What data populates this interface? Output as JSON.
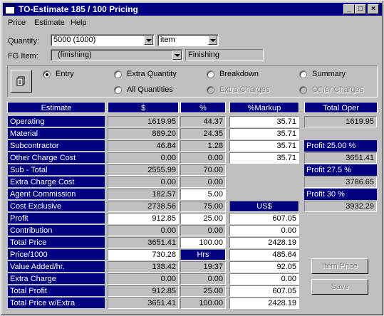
{
  "window": {
    "title": "TO-Estimate 185 / 100  Pricing"
  },
  "menu": [
    {
      "label": "Price"
    },
    {
      "label": "Estimate"
    },
    {
      "label": "Help"
    }
  ],
  "quantity": {
    "label": "Quantity:",
    "value": "5000  (1000)",
    "unit": "item"
  },
  "fg_item": {
    "label": "FG Item:",
    "value": "(finishing)",
    "desc": "Finishing"
  },
  "modes": [
    {
      "label": "Entry",
      "selected": true,
      "enabled": true
    },
    {
      "label": "Extra Quantity",
      "selected": false,
      "enabled": true
    },
    {
      "label": "Breakdown",
      "selected": false,
      "enabled": true
    },
    {
      "label": "Summary",
      "selected": false,
      "enabled": true
    },
    {
      "label": "All Quantities",
      "selected": false,
      "enabled": true
    },
    {
      "label": "Extra Charges",
      "selected": false,
      "enabled": false
    },
    {
      "label": "Other Charges",
      "selected": false,
      "enabled": false
    }
  ],
  "headers": {
    "estimate": "Estimate",
    "dollar": "$",
    "pct": "%",
    "markup": "%Markup",
    "total_oper": "Total Oper"
  },
  "rows": [
    {
      "label": "Operating",
      "dollar": "1619.95",
      "pct": "44.37",
      "markup": "35.71"
    },
    {
      "label": "Material",
      "dollar": "889.20",
      "pct": "24.35",
      "markup": "35.71"
    },
    {
      "label": "Subcontractor",
      "dollar": "46.84",
      "pct": "1.28",
      "markup": "35.71"
    },
    {
      "label": "Other Charge Cost",
      "dollar": "0.00",
      "pct": "0.00",
      "markup": "35.71"
    },
    {
      "label": "Sub - Total",
      "dollar": "2555.99",
      "pct": "70.00",
      "markup": ""
    },
    {
      "label": "Extra Charge Cost",
      "dollar": "0.00",
      "pct": "0.00",
      "markup": ""
    },
    {
      "label": "Agent Commission",
      "dollar": "182.57",
      "pct": "5.00",
      "markup": ""
    },
    {
      "label": "Cost Exclusive",
      "dollar": "2738.56",
      "pct": "75.00",
      "markup": "US$"
    },
    {
      "label": "Profit",
      "dollar": "912.85",
      "pct": "25.00",
      "markup": "607.05"
    },
    {
      "label": "Contribution",
      "dollar": "0.00",
      "pct": "0.00",
      "markup": "0.00"
    },
    {
      "label": "Total Price",
      "dollar": "3651.41",
      "pct": "100.00",
      "markup": "2428.19"
    },
    {
      "label": "Price/1000",
      "dollar": "730.28",
      "pct": "Hrs",
      "markup": "485.64"
    },
    {
      "label": "Value Added/hr.",
      "dollar": "138.42",
      "pct": "19:37",
      "markup": "92.05"
    },
    {
      "label": "Extra Charge",
      "dollar": "0.00",
      "pct": "0.00",
      "markup": "0.00"
    },
    {
      "label": "Total Profit",
      "dollar": "912.85",
      "pct": "25.00",
      "markup": "607.05"
    },
    {
      "label": "Total Price w/Extra",
      "dollar": "3651.41",
      "pct": "100.00",
      "markup": "2428.19"
    }
  ],
  "total_oper": "1619.95",
  "profits": [
    {
      "label": "Profit 25.00  %",
      "value": "3651.41"
    },
    {
      "label": "Profit 27.5  %",
      "value": "3786.65"
    },
    {
      "label": "Profit 30  %",
      "value": "3932.29"
    }
  ],
  "buttons": {
    "item_price": "Item Price",
    "save": "Save"
  }
}
